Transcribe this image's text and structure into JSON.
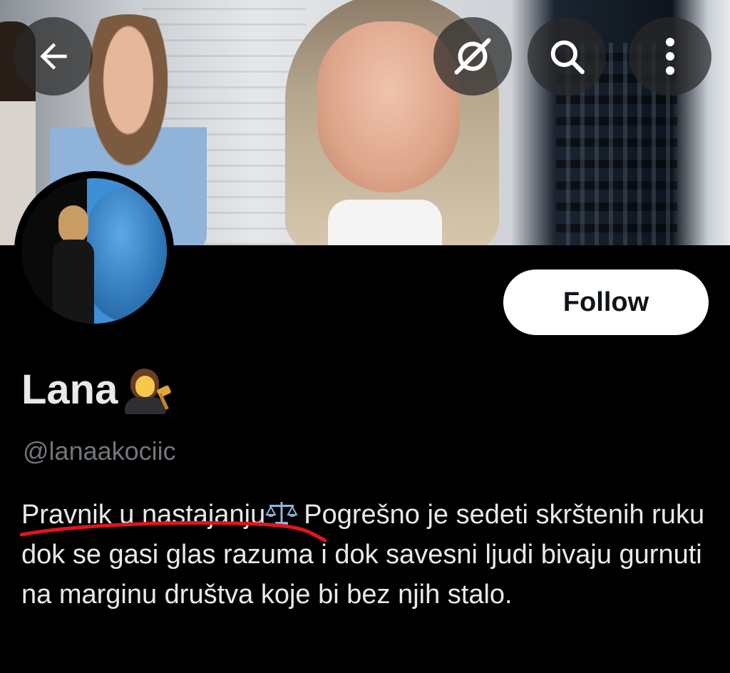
{
  "topbar": {
    "back_icon": "arrow-left-icon",
    "grok_icon": "grok-icon",
    "search_icon": "search-icon",
    "more_icon": "more-vertical-icon"
  },
  "profile": {
    "display_name": "Lana",
    "name_emoji": "woman-judge-emoji",
    "handle": "@lanaakociic",
    "follow_label": "Follow",
    "bio": {
      "part1": "Pravnik u nastajanju",
      "scales_emoji": "balance-scale-emoji",
      "part2": "Pogrešno je sedeti skrštenih ruku dok se gasi glas razuma i dok savesni ljudi bivaju gurnuti na marginu društva koje bi bez njih stalo."
    }
  },
  "colors": {
    "background": "#000000",
    "text_primary": "#e7e9ea",
    "text_secondary": "#71767b",
    "follow_bg": "#ffffff",
    "follow_text": "#0f1419",
    "annotation_red": "#e0151b"
  }
}
